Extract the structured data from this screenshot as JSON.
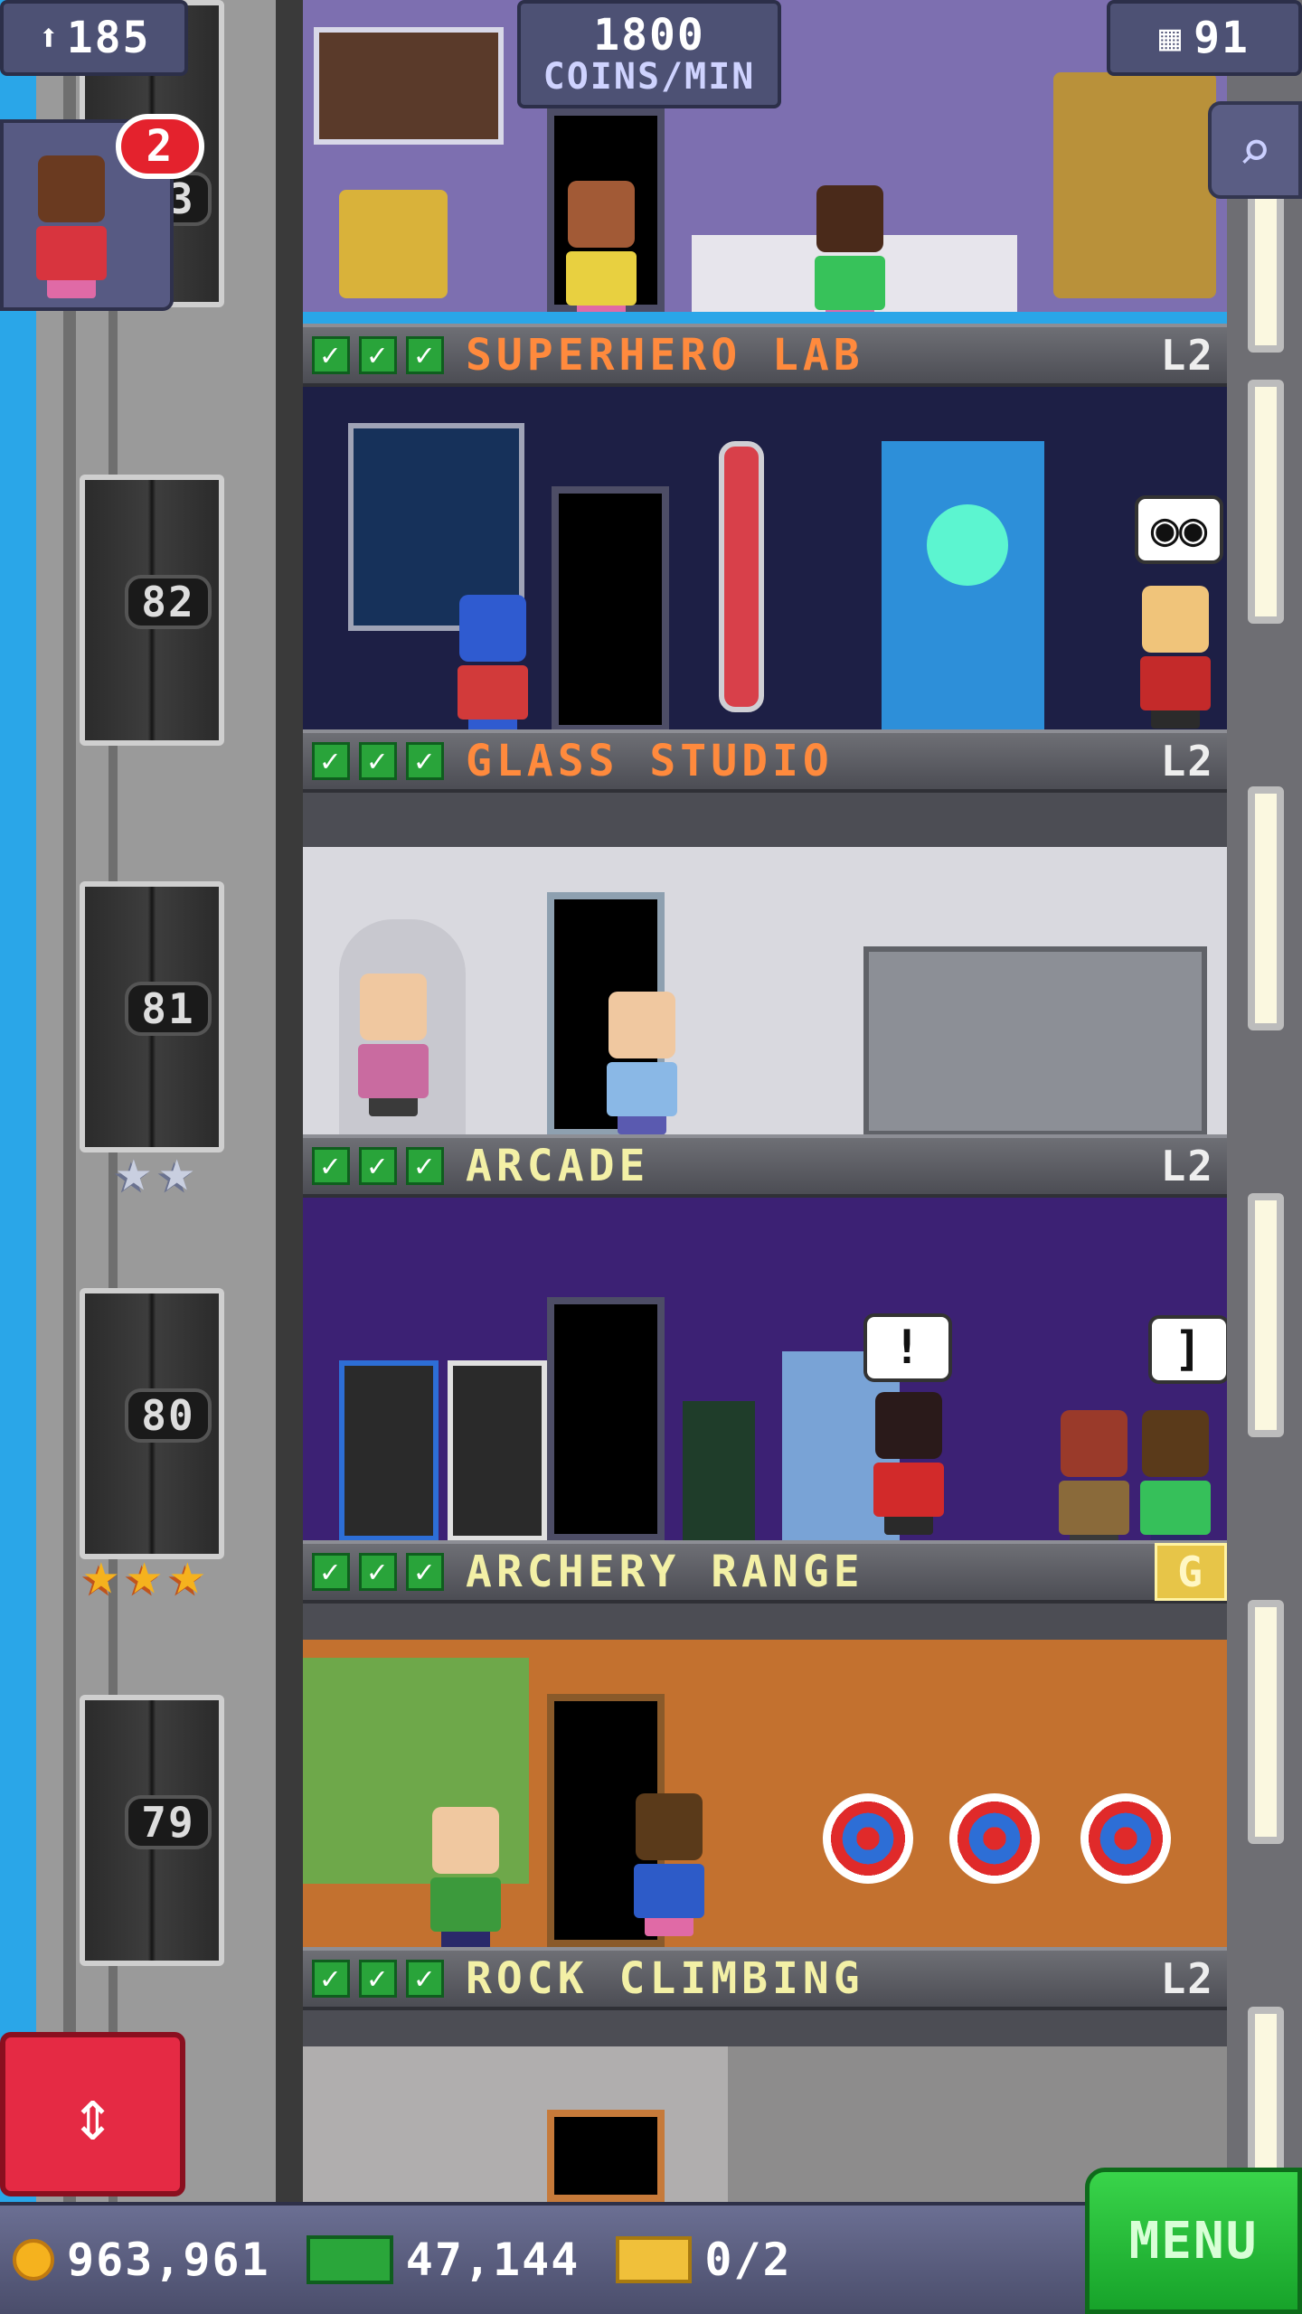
{
  "top_bar": {
    "population": "185",
    "coins_per_min_value": "1800",
    "coins_per_min_unit": "COINS/MIN",
    "floors_count": "91",
    "notification_count": "2"
  },
  "elevator": {
    "floor_labels": [
      "83",
      "82",
      "81",
      "80",
      "79"
    ]
  },
  "floors": [
    {
      "name": "SUPERHERO LAB",
      "level": "L2"
    },
    {
      "name": "GLASS STUDIO",
      "level": "L2"
    },
    {
      "name": "ARCADE",
      "level": "L2"
    },
    {
      "name": "ARCHERY RANGE",
      "level": "G"
    },
    {
      "name": "ROCK CLIMBING",
      "level": "L2"
    }
  ],
  "bubbles": {
    "arcade_left": "!",
    "arcade_right": "]"
  },
  "bottom_bar": {
    "coins": "963,961",
    "bux": "47,144",
    "tickets": "0/2",
    "menu_label": "MENU"
  },
  "colors": {
    "sky": "#2aa6e8",
    "menu_green": "#17a32a",
    "elevator_button_red": "#e52a44",
    "name_orange": "#ff8a3d",
    "name_yellow": "#f3f0a6",
    "level_gold": "#e7c548"
  }
}
